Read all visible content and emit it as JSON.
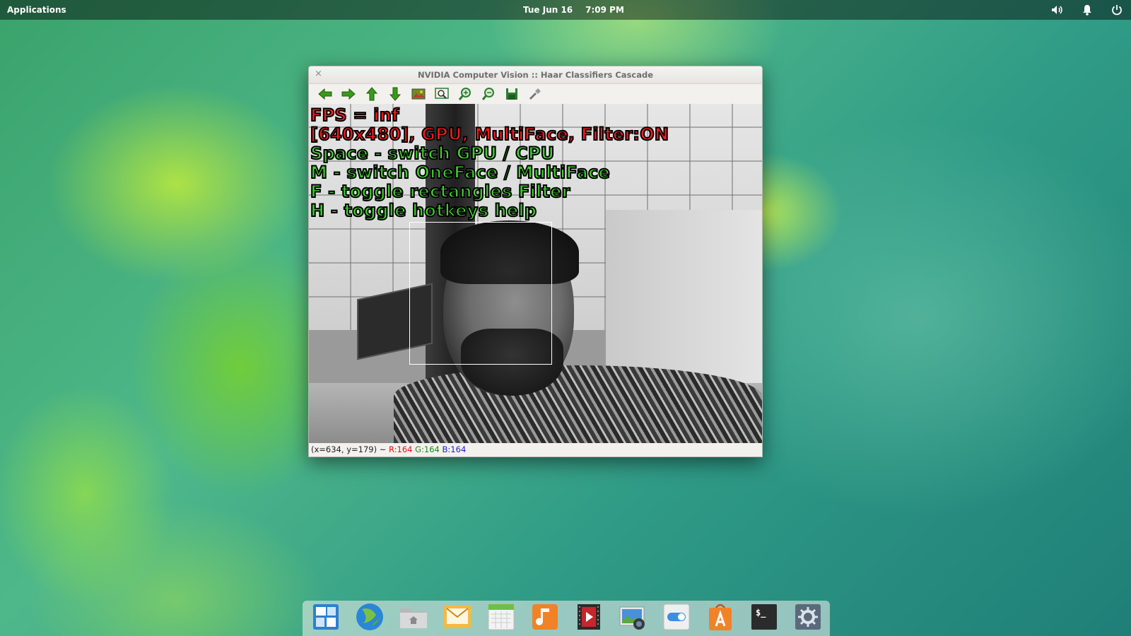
{
  "top_panel": {
    "applications_label": "Applications",
    "date": "Tue Jun 16",
    "time": "7:09 PM",
    "tray_icons": [
      "volume-icon",
      "notifications-icon",
      "power-icon"
    ]
  },
  "window": {
    "title": "NVIDIA Computer Vision :: Haar Classifiers Cascade",
    "close_glyph": "×",
    "toolbar_icons": [
      "arrow-left-icon",
      "arrow-right-icon",
      "arrow-up-icon",
      "arrow-down-icon",
      "image-icon",
      "zoom-fit-icon",
      "zoom-in-icon",
      "zoom-out-icon",
      "save-icon",
      "properties-icon"
    ],
    "overlay": {
      "line1": "FPS = inf",
      "line2": "[640x480], GPU, MultiFace, Filter:ON",
      "line3": "Space - switch GPU / CPU",
      "line4": "M - switch OneFace / MultiFace",
      "line5": "F - toggle rectangles Filter",
      "line6": "H - toggle hotkeys help"
    },
    "status": {
      "coords": "(x=634, y=179) ~",
      "r": "R:164",
      "g": "G:164",
      "b": "B:164"
    }
  },
  "dock": {
    "items": [
      "multitasking-view",
      "web-browser",
      "files",
      "mail",
      "calendar",
      "music",
      "videos",
      "photos",
      "switchboard-toggle",
      "app-center",
      "terminal",
      "system-settings"
    ],
    "terminal_glyph": "$_"
  },
  "colors": {
    "overlay_red": "#ff1a1a",
    "overlay_green": "#3fd02a",
    "toolbar_green": "#3a9a1a"
  }
}
